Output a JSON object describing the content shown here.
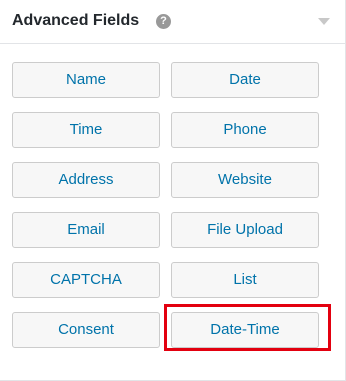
{
  "panel": {
    "title": "Advanced Fields",
    "help_icon": "question-circle-icon",
    "toggle_icon": "triangle-down-icon"
  },
  "fields": [
    {
      "label": "Name"
    },
    {
      "label": "Date"
    },
    {
      "label": "Time"
    },
    {
      "label": "Phone"
    },
    {
      "label": "Address"
    },
    {
      "label": "Website"
    },
    {
      "label": "Email"
    },
    {
      "label": "File Upload"
    },
    {
      "label": "CAPTCHA"
    },
    {
      "label": "List"
    },
    {
      "label": "Consent"
    },
    {
      "label": "Date-Time"
    }
  ],
  "highlighted_field": "Date-Time",
  "colors": {
    "button_text": "#0073aa",
    "button_bg": "#f7f7f7",
    "highlight_border": "#e3000f"
  }
}
